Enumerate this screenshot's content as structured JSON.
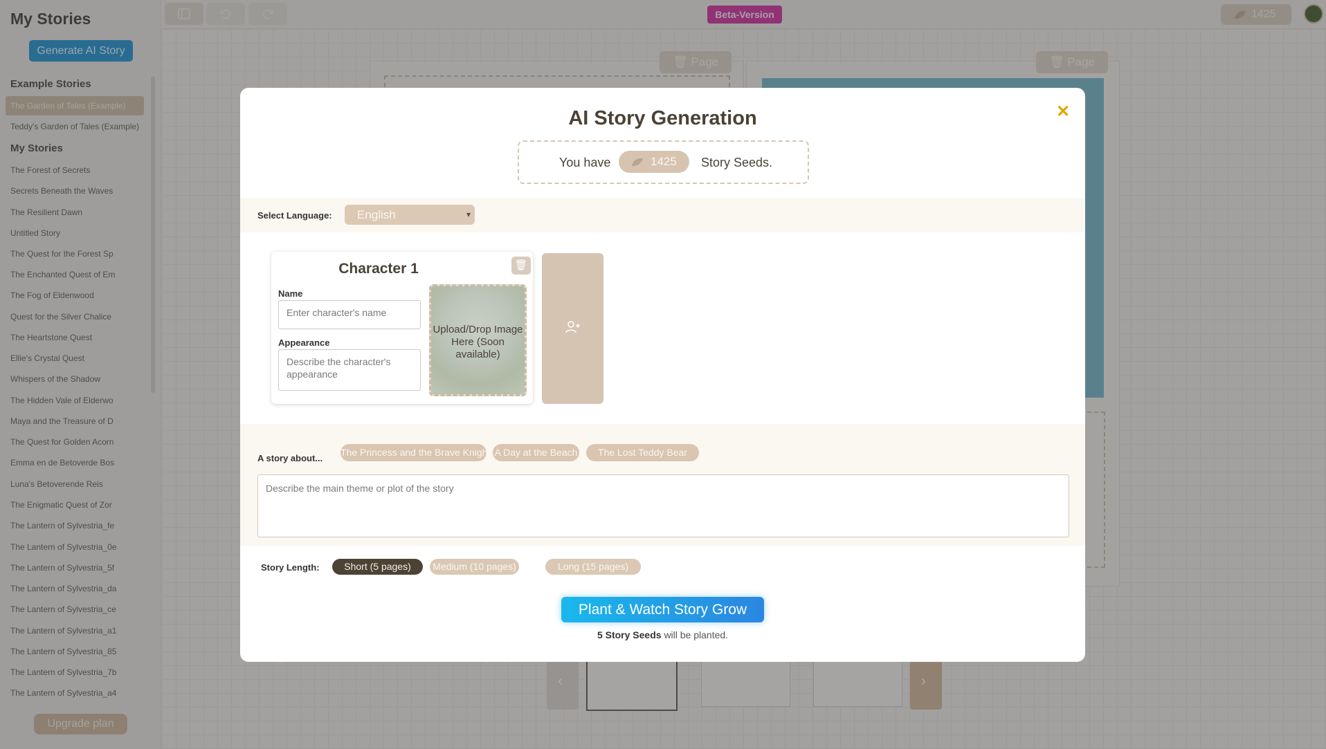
{
  "sidebar": {
    "title": "My Stories",
    "generate_label": "Generate AI Story",
    "example_heading": "Example Stories",
    "examples": [
      "The Garden of Tales (Example)",
      "Teddy's Garden of Tales (Example)"
    ],
    "my_heading": "My Stories",
    "stories": [
      "The Forest of Secrets",
      "Secrets Beneath the Waves",
      "The Resilient Dawn",
      "Untitled Story",
      "The Quest for the Forest Sp",
      "The Enchanted Quest of Em",
      "The Fog of Eldenwood",
      "Quest for the Silver Chalice",
      "The Heartstone Quest",
      "Ellie's Crystal Quest",
      "Whispers of the Shadow",
      "The Hidden Vale of Elderwo",
      "Maya and the Treasure of D",
      "The Quest for Golden Acorn",
      "Emma en de Betoverde Bos",
      "Luna's Betoverende Reis",
      "The Enigmatic Quest of Zor",
      "The Lantern of Sylvestria_fe",
      "The Lantern of Sylvestria_0e",
      "The Lantern of Sylvestria_5f",
      "The Lantern of Sylvestria_da",
      "The Lantern of Sylvestria_ce",
      "The Lantern of Sylvestria_a1",
      "The Lantern of Sylvestria_85",
      "The Lantern of Sylvestria_7b",
      "The Lantern of Sylvestria_a4"
    ],
    "upgrade_label": "Upgrade plan"
  },
  "topbar": {
    "beta_label": "Beta-Version",
    "credits": "1425",
    "sidebar_toggle_icon": "sidebar-toggle-icon",
    "undo_icon": "undo-icon",
    "redo_icon": "redo-icon"
  },
  "canvas": {
    "page_label": "Page"
  },
  "modal": {
    "title": "AI Story Generation",
    "close_glyph": "✕",
    "seeds_pre": "You have",
    "seeds_count": "1425",
    "seeds_post": "Story Seeds.",
    "language_label": "Select Language:",
    "language_value": "English",
    "character": {
      "title": "Character 1",
      "name_label": "Name",
      "name_placeholder": "Enter character's name",
      "appearance_label": "Appearance",
      "appearance_placeholder": "Describe the character's appearance",
      "upload_text": "Upload/Drop Image Here (Soon available)"
    },
    "about_label": "A story about...",
    "suggestions": [
      "The Princess and the Brave Knight",
      "A Day at the Beach",
      "The Lost Teddy Bear"
    ],
    "theme_placeholder": "Describe the main theme or plot of the story",
    "length_label": "Story Length:",
    "lengths": [
      "Short (5 pages)",
      "Medium (10 pages)",
      "Long (15 pages)"
    ],
    "selected_length": "Short (5 pages)",
    "plant_label": "Plant & Watch Story Grow",
    "plant_note_bold": "5 Story Seeds",
    "plant_note_rest": "will be planted."
  },
  "colors": {
    "accent_blue": "#1d8fcf",
    "beta_magenta": "#cf2c9f",
    "tan": "#d6c4b0",
    "dark_brown": "#4c4335",
    "close_gold": "#e0a700"
  }
}
